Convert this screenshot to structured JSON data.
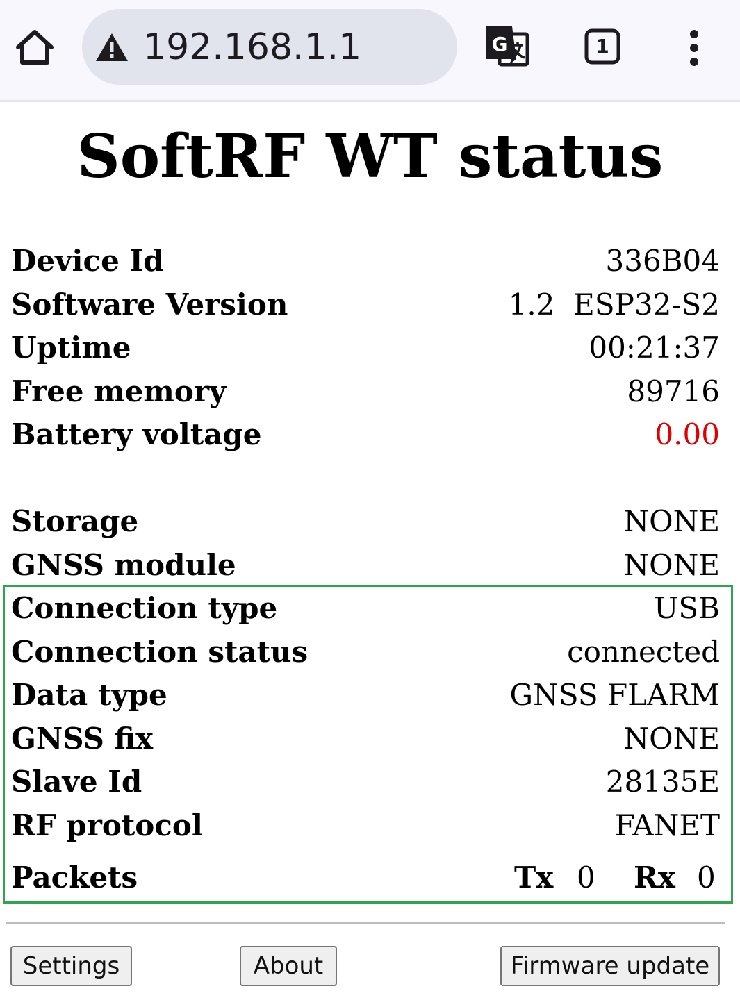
{
  "browser": {
    "url": "192.168.1.1",
    "tab_count": "1",
    "icons": [
      "home-icon",
      "warning-icon",
      "translate-icon",
      "tabs-icon",
      "more-vert-icon"
    ]
  },
  "page": {
    "title": "SoftRF WT status"
  },
  "status": [
    {
      "label": "Device Id",
      "value": "336B04"
    },
    {
      "label": "Software Version",
      "value": "1.2  ESP32-S2"
    },
    {
      "label": "Uptime",
      "value": "00:21:37"
    },
    {
      "label": "Free memory",
      "value": "89716"
    },
    {
      "label": "Battery voltage",
      "value": "0.00"
    }
  ],
  "hardware": [
    {
      "label": "Storage",
      "value": "NONE"
    },
    {
      "label": "GNSS module",
      "value": "NONE"
    }
  ],
  "connection": [
    {
      "label": "Connection type",
      "value": "USB"
    },
    {
      "label": "Connection status",
      "value": "connected"
    },
    {
      "label": "Data type",
      "value": "GNSS FLARM"
    },
    {
      "label": "GNSS fix",
      "value": "NONE"
    },
    {
      "label": "Slave Id",
      "value": "28135E"
    },
    {
      "label": "RF protocol",
      "value": "FANET"
    }
  ],
  "packets": {
    "label": "Packets",
    "tx_label": "Tx",
    "tx_value": "0",
    "rx_label": "Rx",
    "rx_value": "0"
  },
  "buttons": {
    "settings": "Settings",
    "about": "About",
    "firmware_update": "Firmware update"
  },
  "colors": {
    "battery_value": "#e00000",
    "highlight_border": "#2ea44f"
  }
}
